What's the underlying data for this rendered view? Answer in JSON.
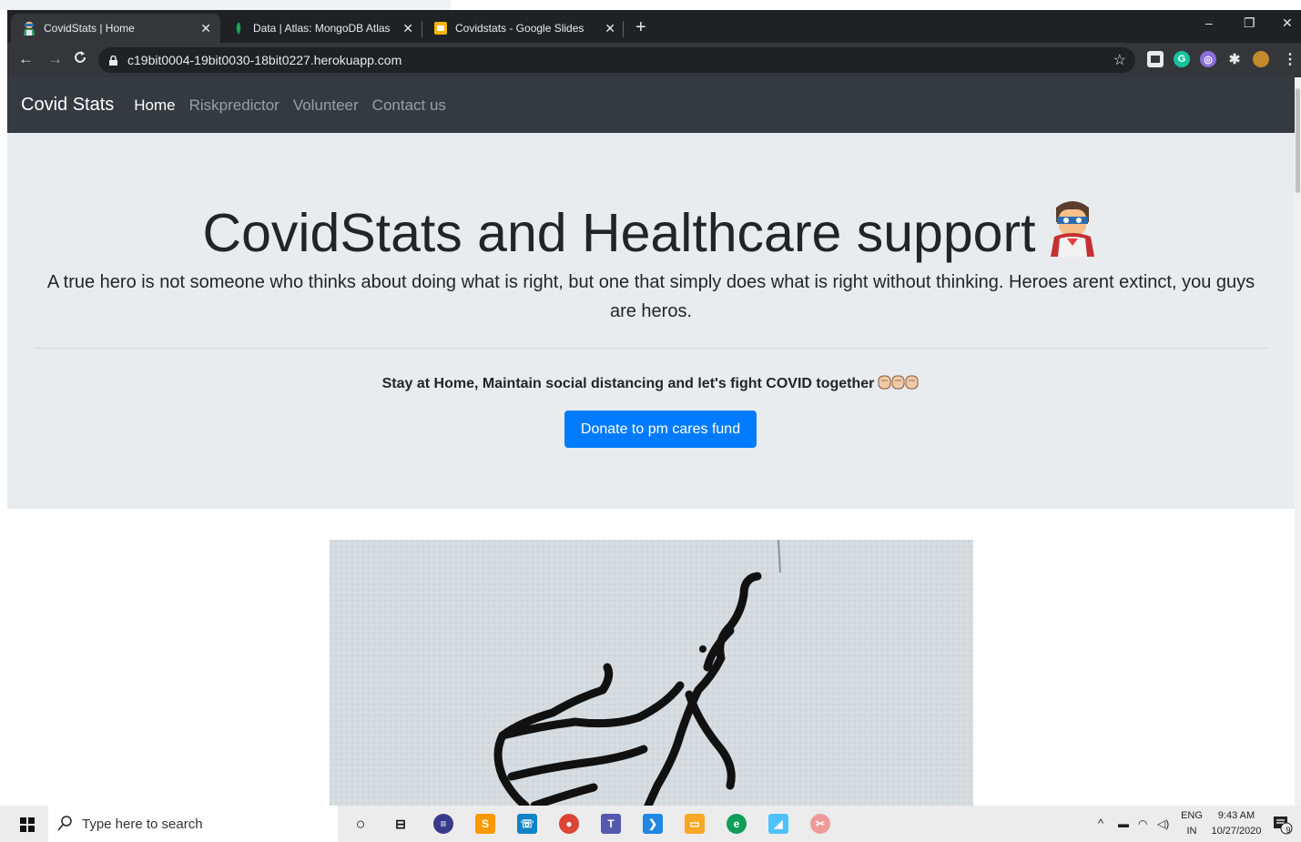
{
  "browser": {
    "tabs": [
      {
        "title": "CovidStats | Home",
        "active": true
      },
      {
        "title": "Data | Atlas: MongoDB Atlas",
        "active": false
      },
      {
        "title": "Covidstats - Google Slides",
        "active": false
      }
    ],
    "new_tab": "+",
    "close_glyph": "✕",
    "url": "c19bit0004-19bit0030-18bit0227.herokuapp.com",
    "window_controls": {
      "minimize": "–",
      "restore": "❐",
      "close": "✕"
    }
  },
  "site": {
    "brand": "Covid Stats",
    "nav": [
      {
        "label": "Home",
        "active": true
      },
      {
        "label": "Riskpredictor",
        "active": false
      },
      {
        "label": "Volunteer",
        "active": false
      },
      {
        "label": "Contact us",
        "active": false
      }
    ],
    "hero_title": "CovidStats and Healthcare support",
    "lead": "A true hero is not someone who thinks about doing what is right, but one that simply does what is right without thinking. Heroes arent extinct, you guys are heros.",
    "stay_home": "Stay at Home, Maintain social distancing and let's fight COVID together",
    "donate_button": "Donate to pm cares fund",
    "colors": {
      "navbar": "#343a40",
      "jumbotron": "#e9ecef",
      "primary": "#007bff"
    }
  },
  "taskbar": {
    "search_placeholder": "Type here to search",
    "language_top": "ENG",
    "language_bottom": "IN",
    "time": "9:43 AM",
    "date": "10/27/2020",
    "notification_count": "9"
  }
}
